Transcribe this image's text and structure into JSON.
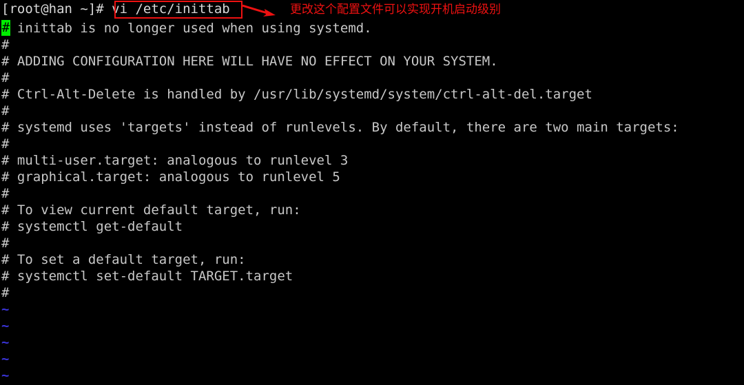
{
  "terminal": {
    "background_color": "#000000",
    "foreground_color": "#d8d8d8",
    "tilde_color": "#3a34d8",
    "cursor_color": "#00ee00",
    "annotation_color": "#ee1111",
    "prompt_line": "[root@han ~]# vi /etc/inittab",
    "prompt_user_host": "[root@han ~]#",
    "command": "vi /etc/inittab",
    "cursor_char": "#",
    "lines": [
      "[root@han ~]# vi /etc/inittab",
      "# inittab is no longer used when using systemd.",
      "#",
      "# ADDING CONFIGURATION HERE WILL HAVE NO EFFECT ON YOUR SYSTEM.",
      "#",
      "# Ctrl-Alt-Delete is handled by /usr/lib/systemd/system/ctrl-alt-del.target",
      "#",
      "# systemd uses 'targets' instead of runlevels. By default, there are two main targets:",
      "#",
      "# multi-user.target: analogous to runlevel 3",
      "# graphical.target: analogous to runlevel 5",
      "#",
      "# To view current default target, run:",
      "# systemctl get-default",
      "#",
      "# To set a default target, run:",
      "# systemctl set-default TARGET.target",
      "#",
      "~",
      "~",
      "~",
      "~",
      "~"
    ]
  },
  "annotation": {
    "highlight_target": "vi /etc/inittab",
    "arrow": "arrow-right",
    "note_text": "更改这个配置文件可以实现开机启动级别"
  }
}
